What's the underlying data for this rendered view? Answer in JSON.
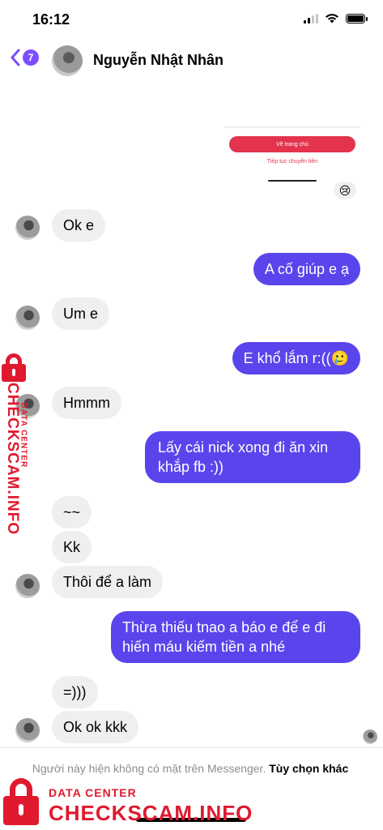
{
  "status_bar": {
    "time": "16:12"
  },
  "header": {
    "back_count": "7",
    "contact_name": "Nguyễn Nhật Nhân"
  },
  "shared_image": {
    "button_label": "Về trang chủ",
    "link_label": "Tiếp tục chuyển tiền",
    "reaction": "😢"
  },
  "messages": [
    {
      "from": "them",
      "text": "Ok e"
    },
    {
      "from": "me",
      "text": "A cố giúp e ạ"
    },
    {
      "from": "them",
      "text": "Um e"
    },
    {
      "from": "me",
      "text": "E khổ lắm r:((🥲"
    },
    {
      "from": "them",
      "text": "Hmmm"
    },
    {
      "from": "me",
      "text": "Lấy cái nick xong đi ăn xin khắp fb :))"
    },
    {
      "from": "them",
      "text": "~~"
    },
    {
      "from": "them",
      "text": "Kk"
    },
    {
      "from": "them",
      "text": "Thôi để a làm"
    },
    {
      "from": "me",
      "text": "Thừa thiếu tnao a báo e để e đi hiến máu kiếm tiền a nhé"
    },
    {
      "from": "them",
      "text": "=)))"
    },
    {
      "from": "them",
      "text": "Ok ok kkk"
    }
  ],
  "notice": {
    "text": "Người này hiện không có mặt trên Messenger.",
    "action": "Tùy chọn khác"
  },
  "watermark": {
    "side_main": "CHECKSCAM.INFO",
    "side_sub": "DATA CENTER",
    "bottom_main": "CHECKSCAM.INFO",
    "bottom_sub": "DATA CENTER"
  },
  "colors": {
    "outgoing": "#5a45ec",
    "incoming": "#efefef",
    "badge": "#7c4dff",
    "watermark": "#e0192e"
  }
}
